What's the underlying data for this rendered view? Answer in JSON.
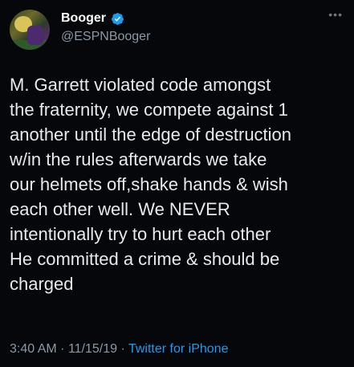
{
  "account": {
    "display_name": "Booger",
    "handle": "@ESPNBooger",
    "verified": true,
    "more_icon": "ellipsis-icon"
  },
  "tweet": {
    "text": "M. Garrett violated code amongst\nthe fraternity, we compete against 1\nanother until the edge of destruction\nw/in the rules afterwards we take\nour helmets off,shake hands & wish\neach other well. We NEVER\nintentionally try to hurt each other\nHe committed a crime & should be\ncharged",
    "time": "3:40 AM",
    "separator": "·",
    "date": "11/15/19",
    "source": "Twitter for iPhone"
  },
  "colors": {
    "background": "#05070a",
    "text": "#e7e9ea",
    "muted": "#8b98a5",
    "link": "#1d9bf0",
    "verified_badge": "#1d9bf0"
  }
}
